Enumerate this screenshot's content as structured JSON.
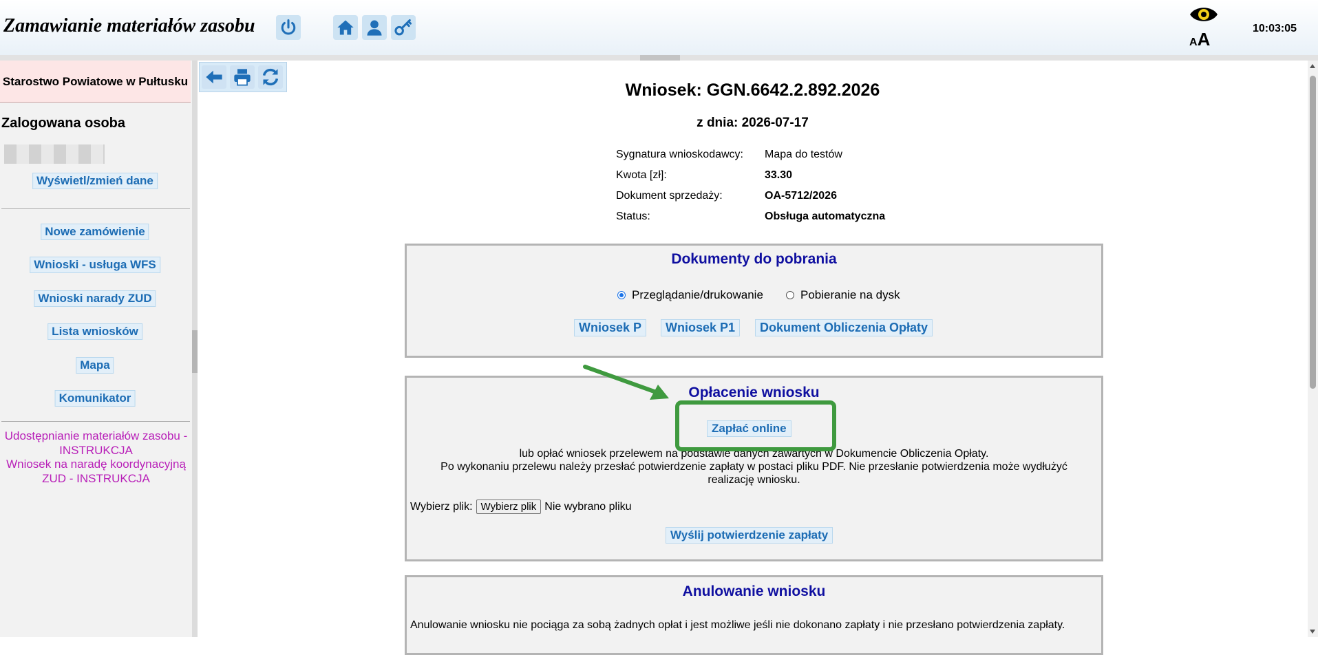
{
  "header": {
    "title": "Zamawianie materiałów zasobu",
    "clock": "10:03:05",
    "font_size_label_small": "A",
    "font_size_label_big": "A",
    "icons": [
      "power-icon",
      "home-icon",
      "user-icon",
      "key-icon",
      "eye-icon"
    ]
  },
  "sidebar": {
    "org_name": "Starostwo Powiatowe w Pułtusku",
    "logged_label": "Zalogowana osoba",
    "edit_data": "Wyświetl/zmień dane",
    "menu": {
      "new_order": "Nowe zamówienie",
      "wfs": "Wnioski - usługa WFS",
      "zud": "Wnioski narady ZUD",
      "list": "Lista wniosków",
      "map": "Mapa",
      "messenger": "Komunikator"
    },
    "instructions": {
      "line1": "Udostępnianie materiałów zasobu - INSTRUKCJA",
      "line2": "Wniosek na naradę koordynacyjną ZUD - INSTRUKCJA"
    }
  },
  "toolbar": {
    "icons": [
      "back-arrow-icon",
      "print-icon",
      "refresh-icon"
    ]
  },
  "request": {
    "title": "Wniosek: GGN.6642.2.892.2026",
    "date": "z dnia: 2026-07-17",
    "fields": {
      "signature_label": "Sygnatura wnioskodawcy:",
      "signature_value": "Mapa do testów",
      "amount_label": "Kwota [zł]:",
      "amount_value": "33.30",
      "sale_doc_label": "Dokument sprzedaży:",
      "sale_doc_value": "OA-5712/2026",
      "status_label": "Status:",
      "status_value": "Obsługa automatyczna"
    }
  },
  "documents": {
    "title": "Dokumenty do pobrania",
    "radio_view": "Przeglądanie/drukowanie",
    "radio_download": "Pobieranie na dysk",
    "selected": "Przeglądanie/drukowanie",
    "btn_p": "Wniosek P",
    "btn_p1": "Wniosek P1",
    "btn_fee_doc": "Dokument Obliczenia Opłaty"
  },
  "payment": {
    "title": "Opłacenie wniosku",
    "pay_online": "Zapłać online",
    "text1": "lub opłać wniosek przelewem na podstawie danych zawartych w Dokumencie Obliczenia Opłaty.",
    "text2": "Po wykonaniu przelewu należy przesłać potwierdzenie zapłaty w postaci pliku PDF. Nie przesłanie potwierdzenia może wydłużyć realizację wniosku.",
    "file_label": "Wybierz plik:",
    "file_button": "Wybierz plik",
    "file_status": "Nie wybrano pliku",
    "send_confirmation": "Wyślij potwierdzenie zapłaty",
    "highlight_color": "#3f9a3f"
  },
  "cancel": {
    "title": "Anulowanie wniosku",
    "text1": "Anulowanie wniosku nie pociąga za sobą żadnych opłat i jest możliwe jeśli nie dokonano zapłaty i nie przesłano potwierdzenia zapłaty."
  },
  "colors": {
    "accent_link": "#1c6cb4",
    "panel_title": "#0f0fa0",
    "instructions": "#b81fb8",
    "org_bg": "#fde6e6"
  }
}
